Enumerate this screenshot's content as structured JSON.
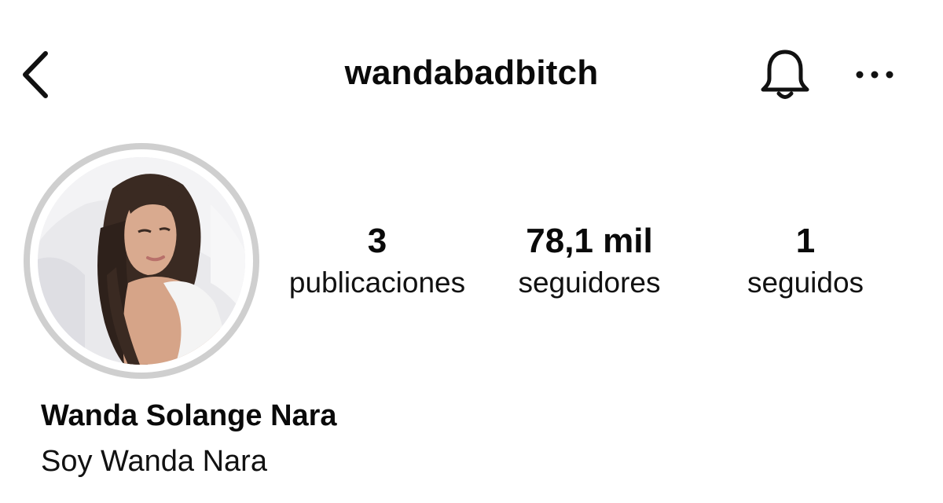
{
  "header": {
    "username": "wandabadbitch",
    "back_icon": "chevron-left-icon",
    "bell_icon": "bell-icon",
    "more_icon": "more-horizontal-icon"
  },
  "profile": {
    "avatar": "profile-photo",
    "ring_color": "#cfcfcf",
    "full_name": "Wanda Solange Nara",
    "bio": "Soy Wanda Nara"
  },
  "stats": {
    "posts": {
      "value": "3",
      "label": "publicaciones"
    },
    "followers": {
      "value": "78,1 mil",
      "label": "seguidores"
    },
    "following": {
      "value": "1",
      "label": "seguidos"
    }
  }
}
